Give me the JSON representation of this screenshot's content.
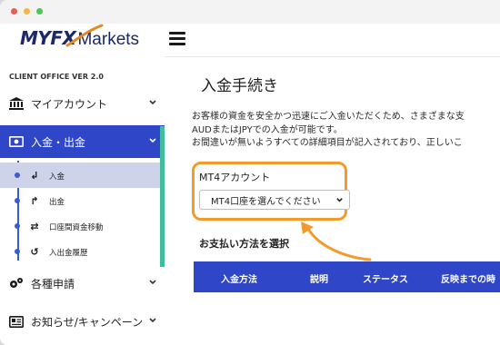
{
  "window": {
    "traffic_lights": [
      "close",
      "minimize",
      "zoom"
    ]
  },
  "header": {
    "logo_myfx": "MYFX",
    "logo_markets": "Markets",
    "menu_icon": "hamburger-icon"
  },
  "sidebar": {
    "version": "CLIENT OFFICE VER 2.0",
    "items": [
      {
        "label": "マイアカウント",
        "icon": "bank-icon",
        "expanded": false
      },
      {
        "label": "入金・出金",
        "icon": "money-icon",
        "expanded": true
      },
      {
        "label": "各種申請",
        "icon": "gears-icon",
        "expanded": false
      },
      {
        "label": "お知らせ/キャンペーン",
        "icon": "newspaper-icon",
        "expanded": false
      }
    ],
    "subitems": [
      {
        "label": "入金",
        "icon": "deposit-arrow-icon",
        "selected": true
      },
      {
        "label": "出金",
        "icon": "withdraw-arrow-icon",
        "selected": false
      },
      {
        "label": "口座間資金移動",
        "icon": "transfer-arrows-icon",
        "selected": false
      },
      {
        "label": "入出金履歴",
        "icon": "history-icon",
        "selected": false
      }
    ],
    "colors": {
      "active_bg": "#2f46c8",
      "accent_bar": "#3cbf9a",
      "selected_bg": "#cfd3ea"
    }
  },
  "main": {
    "title": "入金手続き",
    "description": [
      "お客様の資金を安全かつ迅速にご入金いただくため、さまざまな支",
      "AUDまたはJPYでの入金が可能です。",
      "お間違いが無いようすべての詳細項目が記入されており、正しいこ"
    ],
    "mt4_account_label": "MT4アカウント",
    "mt4_select": {
      "value": "MT4口座を選んでください"
    },
    "payment_method_label": "お支払い方法を選択",
    "table_headers": [
      "入金方法",
      "説明",
      "ステータス",
      "反映までの時"
    ],
    "colors": {
      "highlight": "#f39a2b",
      "table_header_bg": "#2f46c8"
    }
  }
}
